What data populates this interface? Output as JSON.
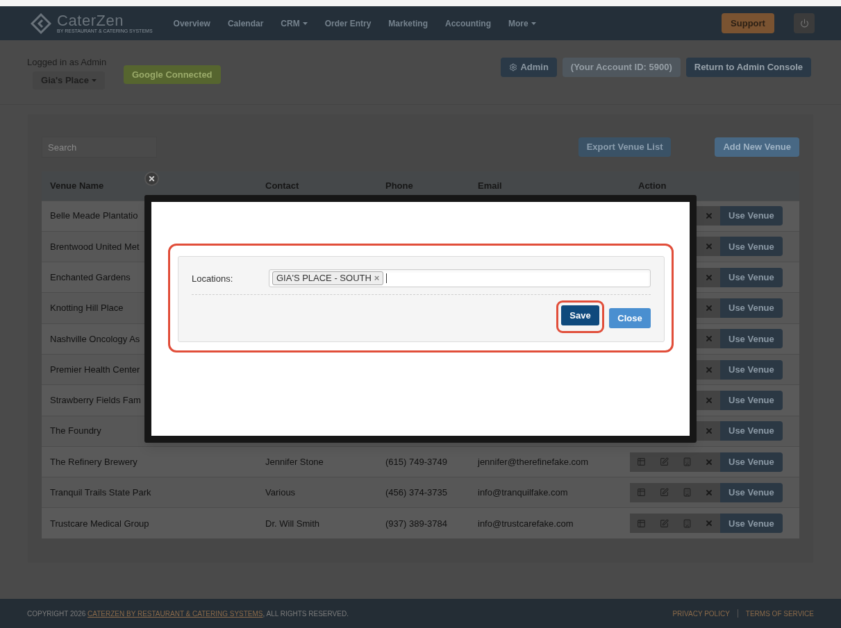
{
  "navbar": {
    "logo": "CaterZen",
    "logo_tagline": "BY RESTAURANT & CATERING SYSTEMS",
    "links": [
      {
        "label": "Overview",
        "dropdown": false
      },
      {
        "label": "Calendar",
        "dropdown": false
      },
      {
        "label": "CRM",
        "dropdown": true
      },
      {
        "label": "Order Entry",
        "dropdown": false
      },
      {
        "label": "Marketing",
        "dropdown": false
      },
      {
        "label": "Accounting",
        "dropdown": false
      },
      {
        "label": "More",
        "dropdown": true
      }
    ],
    "support": "Support"
  },
  "account": {
    "logged_in": "Logged in as Admin",
    "location": "Gia's Place",
    "google": "Google Connected",
    "admin": "Admin",
    "account_id": "(Your Account ID: 5900)",
    "return": "Return to Admin Console"
  },
  "search": {
    "placeholder": "Search"
  },
  "export": "Export Venue List",
  "add": "Add New Venue",
  "table": {
    "columns": [
      "Venue Name",
      "Contact",
      "Phone",
      "Email",
      "Action"
    ],
    "rows": [
      {
        "name": "Belle Meade Plantatio",
        "use": "Use Venue"
      },
      {
        "name": "Brentwood United Met",
        "use": "Use Venue"
      },
      {
        "name": "Enchanted Gardens",
        "use": "Use Venue"
      },
      {
        "name": "Knotting Hill Place",
        "use": "Use Venue"
      },
      {
        "name": "Nashville Oncology As",
        "use": "Use Venue"
      },
      {
        "name": "Premier Health Center",
        "use": "Use Venue"
      },
      {
        "name": "Strawberry Fields Fam",
        "use": "Use Venue"
      },
      {
        "name": "The Foundry",
        "use": "Use Venue"
      },
      {
        "name": "The Refinery Brewery",
        "contact": "Jennifer Stone",
        "phone": "(615) 749-3749",
        "email": "jennifer@therefinefake.com",
        "use": "Use Venue"
      },
      {
        "name": "Tranquil Trails State Park",
        "contact": "Various",
        "phone": "(456) 374-3735",
        "email": "info@tranquilfake.com",
        "use": "Use Venue"
      },
      {
        "name": "Trustcare Medical Group",
        "contact": "Dr. Will Smith",
        "phone": "(937) 389-3784",
        "email": "info@trustcarefake.com",
        "use": "Use Venue"
      }
    ]
  },
  "modal": {
    "label": "Locations:",
    "tags": [
      {
        "label": "GIA'S PLACE - SOUTH",
        "remove": "×"
      }
    ],
    "save": "Save",
    "close": "Close"
  },
  "footer": {
    "copyright": "COPYRIGHT 2026 ",
    "company": "CATERZEN BY RESTAURANT & CATERING SYSTEMS",
    "rights": ", ALL RIGHTS RESERVED.",
    "links": [
      "PRIVACY POLICY",
      "TERMS OF SERVICE"
    ]
  }
}
